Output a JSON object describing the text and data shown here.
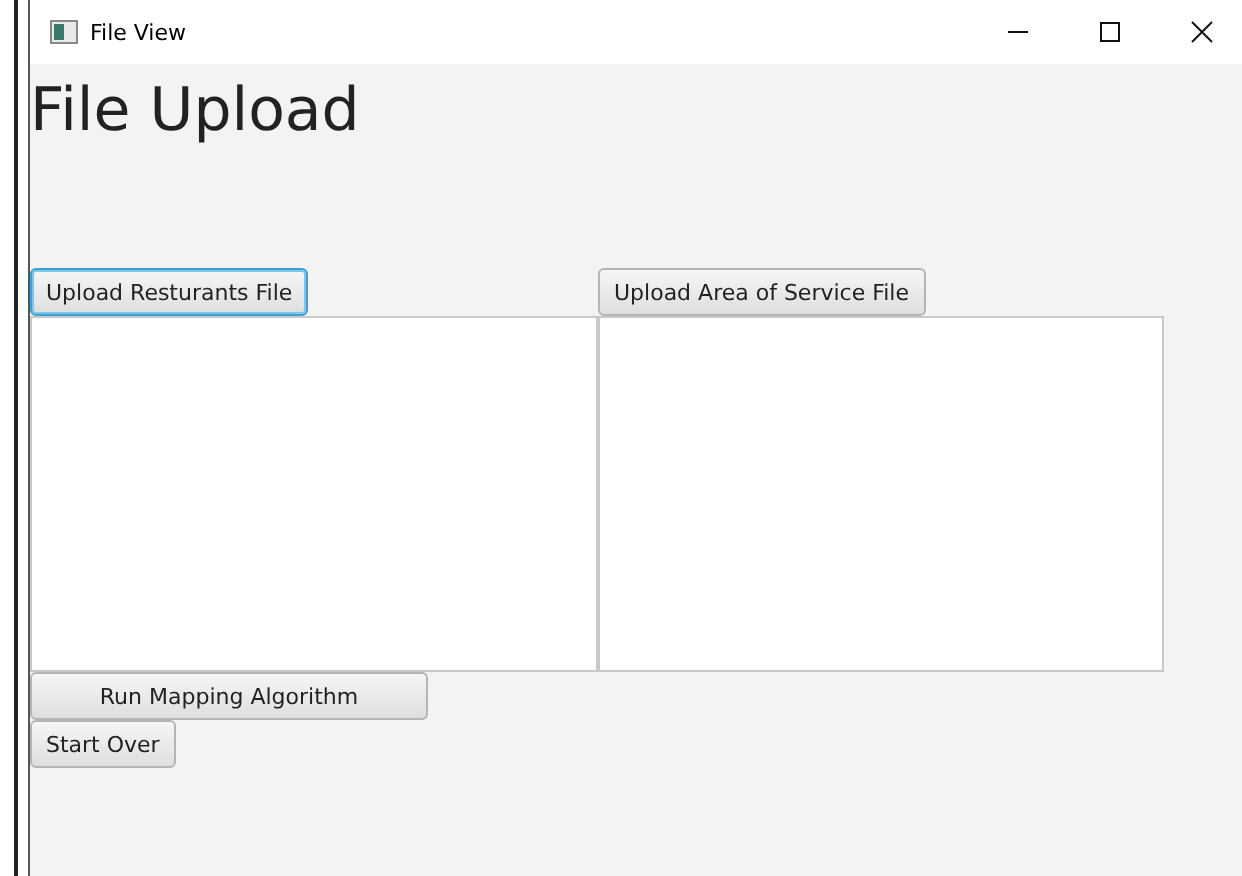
{
  "window": {
    "title": "File View"
  },
  "heading": "File Upload",
  "upload_panels": [
    {
      "button": "Upload Resturants File",
      "focused": true
    },
    {
      "button": "Upload Area of Service File",
      "focused": false
    }
  ],
  "run_button": "Run Mapping Algorithm",
  "start_over_button": "Start Over"
}
